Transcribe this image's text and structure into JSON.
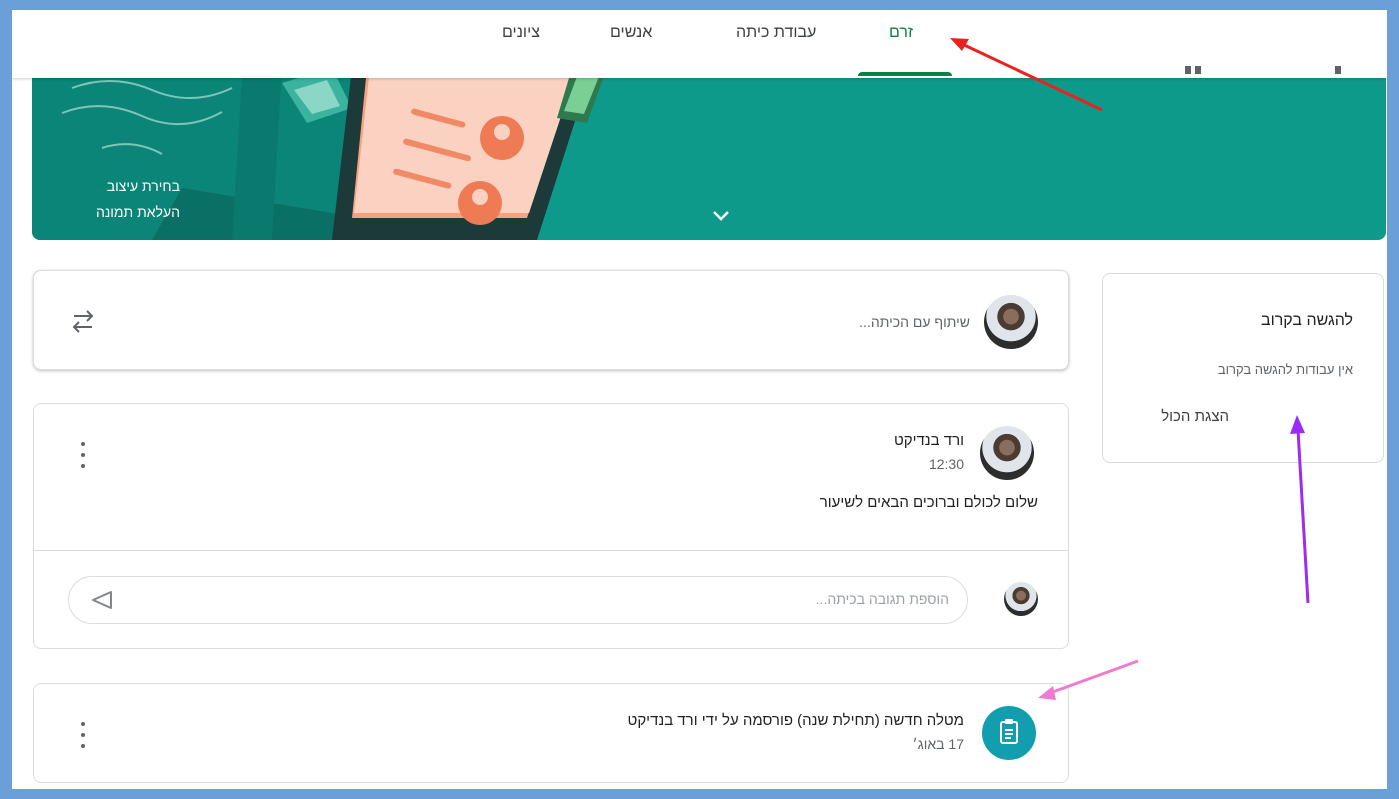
{
  "tabs": {
    "stream": "זרם",
    "classwork": "עבודת כיתה",
    "people": "אנשים",
    "grades": "ציונים"
  },
  "banner": {
    "select_theme": "בחירת עיצוב",
    "upload_photo": "העלאת תמונה",
    "expand_icon": "chevron-down-icon"
  },
  "share": {
    "placeholder": "שיתוף עם הכיתה...",
    "repost_icon": "repost-icon"
  },
  "post": {
    "author": "ורד בנדיקט",
    "time": "12:30",
    "body": "שלום לכולם וברוכים הבאים לשיעור",
    "comment_placeholder": "הוספת תגובה בכיתה...",
    "send_icon": "send-icon",
    "menu_icon": "more-vert-icon"
  },
  "assignment": {
    "title": "מטלה חדשה (תחילת שנה) פורסמה על ידי ורד בנדיקט",
    "date": "17 באוג׳",
    "icon": "assignment-icon",
    "menu_icon": "more-vert-icon"
  },
  "upcoming": {
    "heading": "להגשה בקרוב",
    "empty": "אין עבודות להגשה בקרוב",
    "view_all": "הצגת הכול"
  },
  "colors": {
    "accent": "#0b8043",
    "banner": "#0e9a8a",
    "assignment_icon_bg": "#129eaf",
    "arrow_red": "#e8231f",
    "arrow_purple": "#9b2cf0",
    "arrow_pink": "#f07ad0"
  }
}
